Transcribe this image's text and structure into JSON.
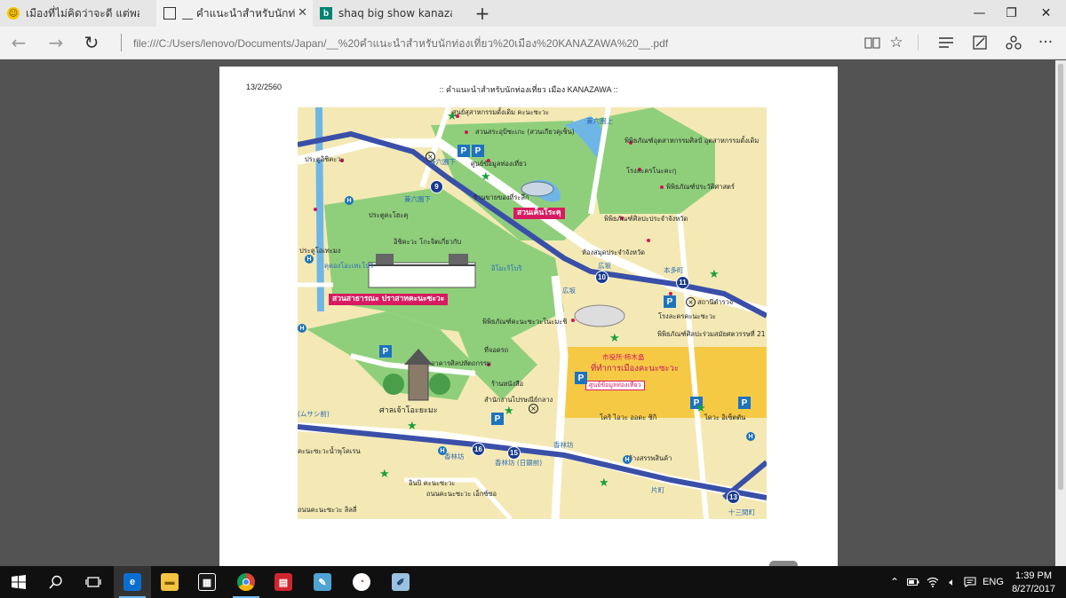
{
  "tabs": [
    {
      "title": "เมืองที่ไม่คิดว่าจะดี แต่พอไปแล้ว เ",
      "icon": "emoji-face-icon"
    },
    {
      "title": "__ คำแนะนำสำหรับนักท่องเที",
      "icon": "document-icon"
    },
    {
      "title": "shaq big show kanazawa - B",
      "icon": "bing-icon"
    }
  ],
  "new_tab_icon": "+",
  "window_controls": {
    "minimize": "—",
    "restore": "❐",
    "close": "✕"
  },
  "address_bar": {
    "url": "file:///C:/Users/lenovo/Documents/Japan/__%20คำแนะนำสำหรับนักท่องเที่ยว%20เมือง%20KANAZAWA%20__.pdf"
  },
  "nav_icons": {
    "back": "←",
    "forward": "→",
    "refresh": "↻"
  },
  "pdf": {
    "date": "13/2/2560",
    "header": ":: คำแนะนำสำหรับนักท่องเที่ยว เมือง KANAZAWA ::"
  },
  "map": {
    "labels": {
      "kenrokuen": "สวนเค็นโระคุ",
      "castle_park": "สวนสาธารณะ ปราสาทคะนะซะวะ",
      "shrine": "ศาลเจ้าโอะยะมะ",
      "city_hall_jp": "市役所·柿木畠",
      "city_hall_th": "ที่ทำการเมืองคะนะซะวะ",
      "tourist_info": "ศูนย์ข้อมูลท่องเที่ยว",
      "kenrokuen_shita": "兼六園下",
      "kenrokuen_shita2": "兼六園下",
      "hirosaka": "広坂",
      "hirosaka2": "広坂",
      "honda": "本多町",
      "korinbo": "香林坊",
      "korinbo2": "香林坊",
      "korinbo3": "香林坊 (日銀前)",
      "katamachi": "片町",
      "jusangen": "十三間町",
      "musashi": "(ムサシ前)",
      "l1": "ศูนย์สุสาหกรรมดั้งเดิม คะนะซะวะ",
      "l2": "สวนสระอุบิซะเกะ (สวนเกียวคุเซ็น)",
      "l3": "ศูนย์ข้อมูลท่องเที่ยว",
      "l4": "ร้านขายของที่ระลึก",
      "l5": "พิพิธภัณฑ์อุตสาหกรรมศิลป์ อุตสาหกรรมดั้งเดิม",
      "l6": "โรงละครโนะคะกุ",
      "l7": "พิพิธภัณฑ์ประวัติศาสตร์",
      "l8": "พิพิธภัณฑ์ศิลปะประจำจังหวัด",
      "l9": "ห้องสมุดประจำจังหวัด",
      "l10": "ประตูอิชิคะวะ",
      "l11": "ประตูคะโฮะคุ",
      "l12": "ประตูโอเทะมง",
      "l13": "คุคองโอะเทะโบริ",
      "l14": "อิชิคะวะ โกะจิตเกี่ยวกับ",
      "l15": "อิโมะริโบริ",
      "l16": "พิพิธภัณฑ์คะนะซะวะโนะมะชิ",
      "l17": "พิพิธภัณฑ์ศิลปะร่วมสมัยศตวรรษที่ 21",
      "l18": "โรงละครคะนะซะวะ",
      "l19": "สถานีตำรวจ",
      "l20": "อาคารศิลปหัตถกรรม",
      "l21": "ที่จอดรถ",
      "l22": "ร้านหนังสือ",
      "l23": "สำนักงานไปรษณีย์กลาง",
      "l24": "โคริ ไอวะ ออดะ ชิกิ",
      "l25": "ไดวะ อิเซ็ตตัน",
      "l26": "คะนะซะวะน้ำพุโคเรน",
      "l27": "ห้างสรรพสินค้า",
      "l28": "อินบิ คะนะซะวะ",
      "l29": "ถนนคะนะซะวะ เอ็กซ์ซอ",
      "l30": "ถนนคะนะซะวะ ลิลลี่"
    }
  },
  "taskbar": {
    "time": "1:39 PM",
    "date": "8/27/2017",
    "language": "ENG"
  }
}
